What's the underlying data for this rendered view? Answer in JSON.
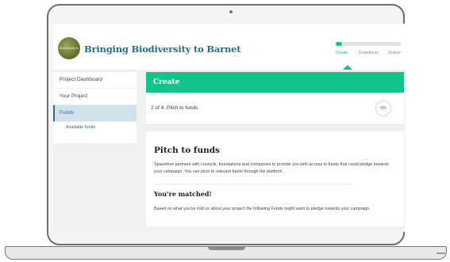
{
  "header": {
    "logo_text": "Biodiversity to Barnet",
    "project_title": "Bringing Biodiversity to Barnet",
    "progress_fraction": 0.1,
    "stages": [
      "Create",
      "Crowdfund",
      "Deliver"
    ],
    "active_stage": "Create"
  },
  "sidebar": {
    "items": [
      {
        "label": "Project Dashboard"
      },
      {
        "label": "Your Project"
      },
      {
        "label": "Funds"
      }
    ],
    "sub_items": [
      {
        "label": "Available funds"
      }
    ]
  },
  "main": {
    "section_title": "Create",
    "step_text": "2 of 4. Pitch to funds",
    "step_percent": "0%",
    "pitch_title": "Pitch to funds",
    "pitch_description": "Spacehive partners with councils, foundations and companies to provide you with access to funds that could pledge towards your campaign. You can pitch to relevant funds through the platform.",
    "matched_title": "You're matched!",
    "matched_description": "Based on what you've told us about your project the following Funds might want to pledge towards your campaign"
  },
  "colors": {
    "accent": "#12c38a",
    "brand": "#2a6c84",
    "active_nav_bg": "#cfe2ec"
  }
}
